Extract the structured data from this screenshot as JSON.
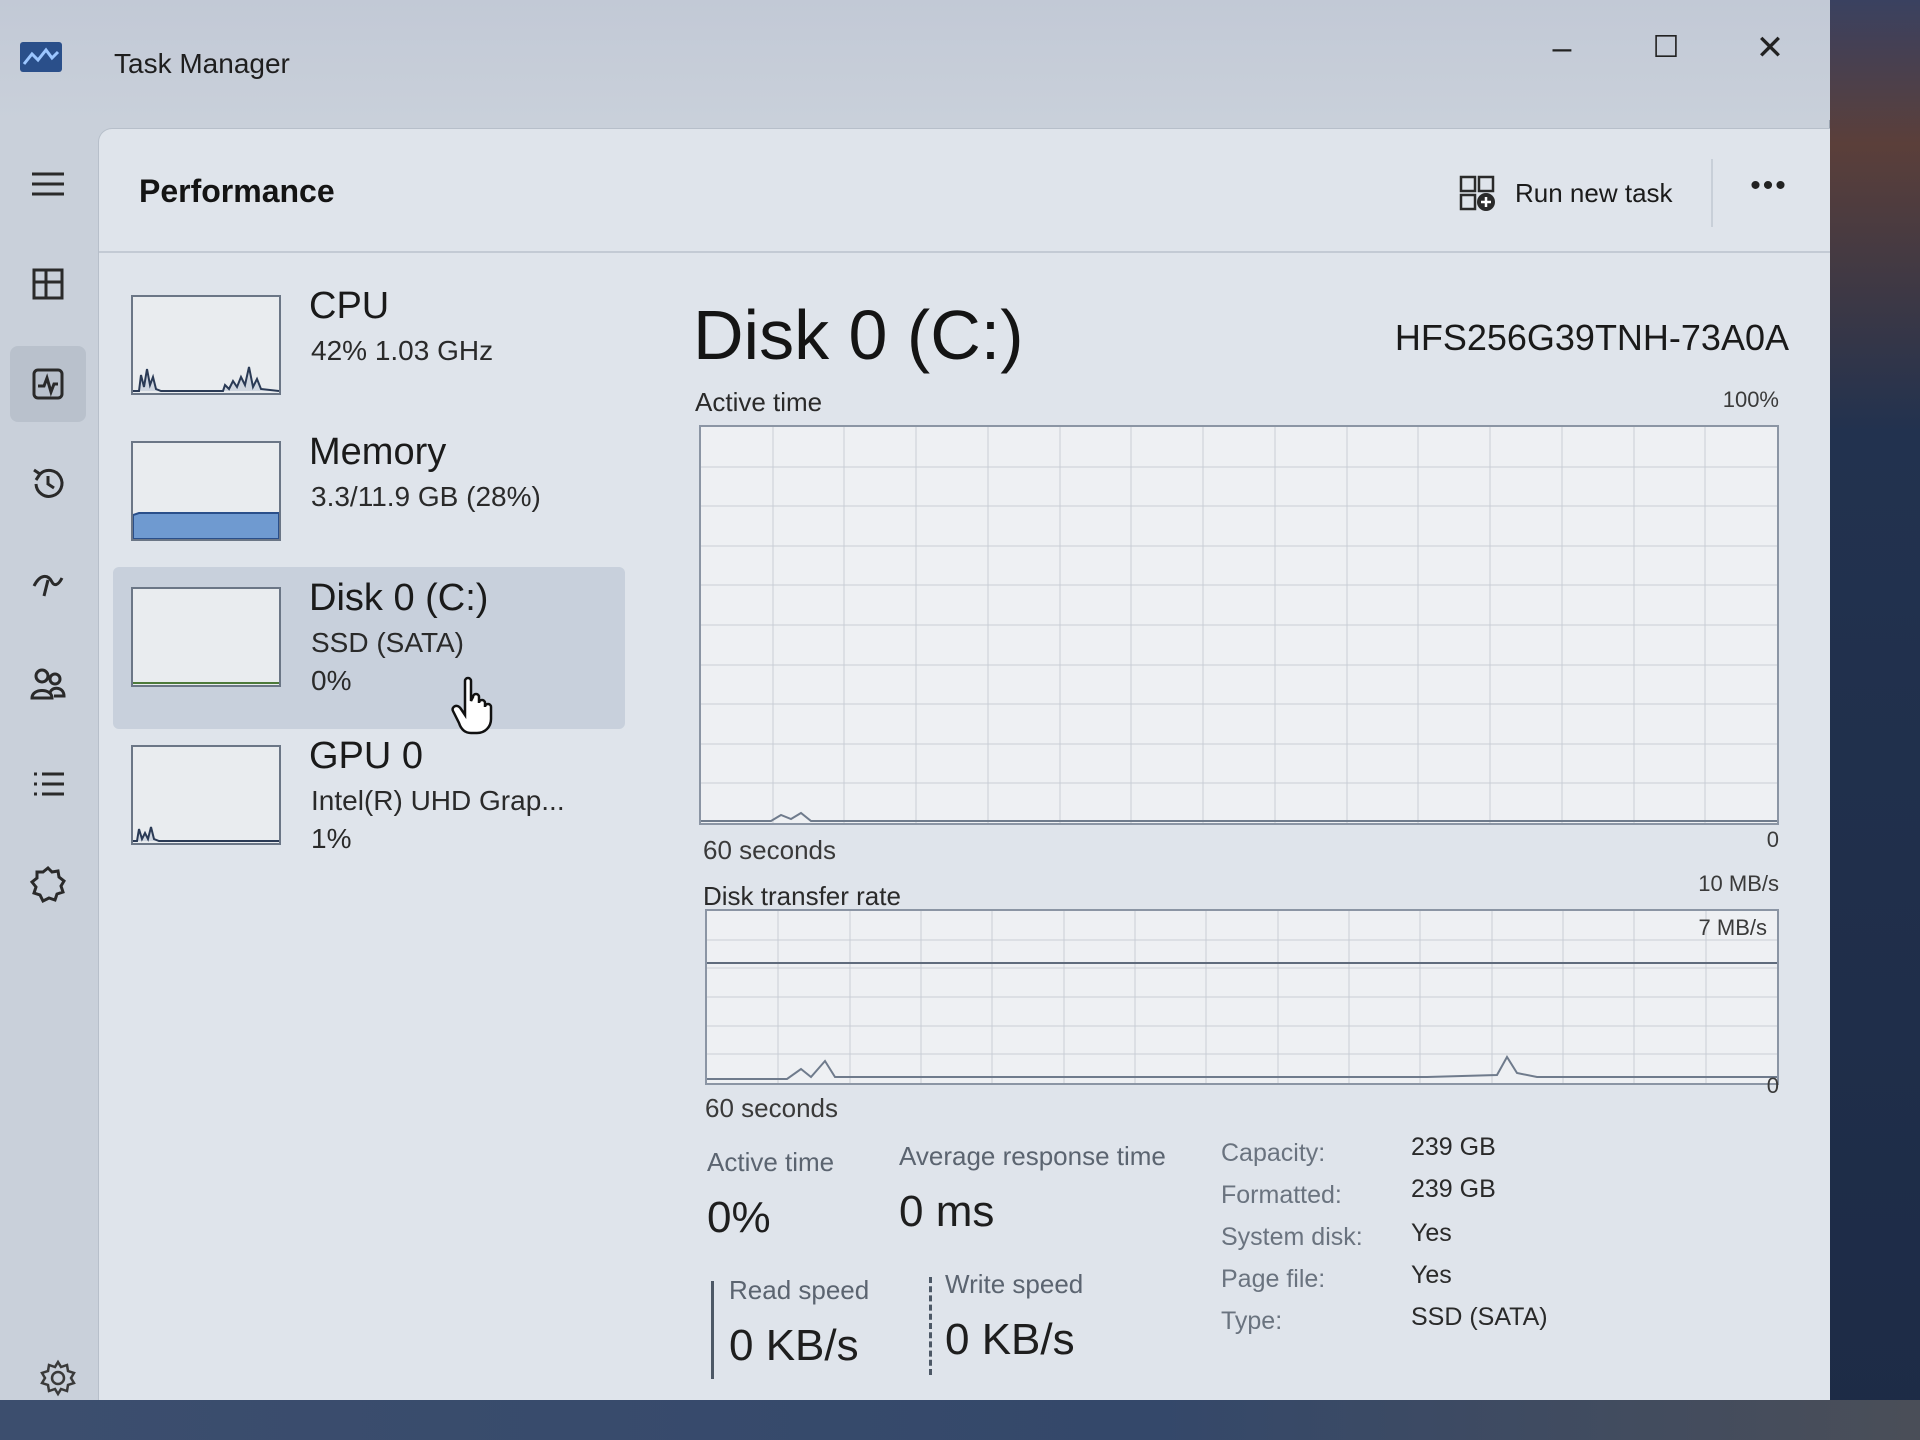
{
  "window": {
    "title": "Task Manager",
    "controls": {
      "minimize": "–",
      "maximize": "☐",
      "close": "✕"
    }
  },
  "header": {
    "title": "Performance",
    "run_new_task": "Run new task",
    "more": "•••"
  },
  "nav": {
    "items": [
      {
        "icon": "hamburger-menu-icon"
      },
      {
        "icon": "processes-icon"
      },
      {
        "icon": "performance-icon",
        "active": true
      },
      {
        "icon": "app-history-icon"
      },
      {
        "icon": "startup-apps-icon"
      },
      {
        "icon": "users-icon"
      },
      {
        "icon": "details-icon"
      },
      {
        "icon": "services-icon"
      }
    ],
    "settings_icon": "settings-icon"
  },
  "devices": [
    {
      "name": "CPU",
      "sub": "42%  1.03 GHz",
      "sub2": ""
    },
    {
      "name": "Memory",
      "sub": "3.3/11.9 GB (28%)",
      "sub2": ""
    },
    {
      "name": "Disk 0 (C:)",
      "sub": "SSD (SATA)",
      "sub2": "0%",
      "selected": true
    },
    {
      "name": "GPU 0",
      "sub": "Intel(R) UHD Grap...",
      "sub2": "1%"
    }
  ],
  "detail": {
    "title": "Disk 0 (C:)",
    "model": "HFS256G39TNH-73A0A",
    "active_time_graph": {
      "label": "Active time",
      "max": "100%",
      "span": "60 seconds",
      "min": "0"
    },
    "transfer_graph": {
      "label": "Disk transfer rate",
      "max": "10 MB/s",
      "line_label": "7 MB/s",
      "span": "60 seconds",
      "min": "0"
    },
    "stats": {
      "active_time_label": "Active time",
      "active_time_value": "0%",
      "avg_response_label": "Average response time",
      "avg_response_value": "0 ms",
      "read_speed_label": "Read speed",
      "read_speed_value": "0 KB/s",
      "write_speed_label": "Write speed",
      "write_speed_value": "0 KB/s"
    },
    "properties": [
      {
        "label": "Capacity:",
        "value": "239 GB"
      },
      {
        "label": "Formatted:",
        "value": "239 GB"
      },
      {
        "label": "System disk:",
        "value": "Yes"
      },
      {
        "label": "Page file:",
        "value": "Yes"
      },
      {
        "label": "Type:",
        "value": "SSD (SATA)"
      }
    ]
  },
  "colors": {
    "accent": "#3b6fb0",
    "graph_line": "#6f7b8c",
    "memory_fill": "#6f9ad0"
  }
}
